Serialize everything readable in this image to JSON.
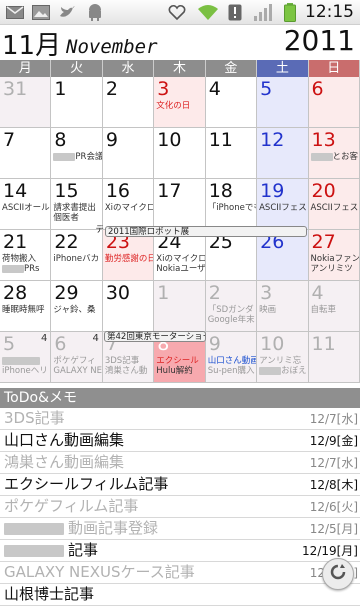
{
  "status": {
    "time": "12:15",
    "icons": [
      "mail-icon",
      "gallery-icon",
      "twitter-icon",
      "android-icon",
      "heart-icon",
      "wifi-icon",
      "alert-icon",
      "signal-icon",
      "battery-icon"
    ]
  },
  "header": {
    "month_label": "11月",
    "month_english": "November",
    "year": "2011"
  },
  "weekdays": [
    "月",
    "火",
    "水",
    "木",
    "金",
    "土",
    "日"
  ],
  "weeks": [
    {
      "days": [
        {
          "num": "31",
          "type": "other"
        },
        {
          "num": "1"
        },
        {
          "num": "2"
        },
        {
          "num": "3",
          "type": "hol",
          "events": [
            {
              "text": "文化の日",
              "color": "red"
            }
          ]
        },
        {
          "num": "4"
        },
        {
          "num": "5",
          "type": "sat"
        },
        {
          "num": "6",
          "type": "sun"
        }
      ]
    },
    {
      "days": [
        {
          "num": "7"
        },
        {
          "num": "8",
          "events": [
            {
              "text": "PR会議",
              "blur_before": true
            }
          ]
        },
        {
          "num": "9"
        },
        {
          "num": "10"
        },
        {
          "num": "11"
        },
        {
          "num": "12",
          "type": "sat"
        },
        {
          "num": "13",
          "type": "sun",
          "events": [
            {
              "text": "とお客",
              "blur_before": true
            }
          ]
        }
      ]
    },
    {
      "days": [
        {
          "num": "14",
          "events": [
            {
              "text": "ASCIIオール"
            }
          ]
        },
        {
          "num": "15",
          "events": [
            {
              "text": "請求書提出"
            },
            {
              "text": "個医者"
            }
          ]
        },
        {
          "num": "16",
          "events": [
            {
              "text": "Xiのマイクロ"
            }
          ]
        },
        {
          "num": "17"
        },
        {
          "num": "18",
          "events": [
            {
              "text": "「iPhoneでも"
            }
          ]
        },
        {
          "num": "19",
          "type": "sat",
          "events": [
            {
              "text": "ASCIIフェス"
            }
          ]
        },
        {
          "num": "20",
          "type": "sun",
          "events": [
            {
              "text": "ASCIIフェス"
            }
          ]
        }
      ]
    },
    {
      "days": [
        {
          "num": "21",
          "events": [
            {
              "text": "荷物搬入"
            },
            {
              "text": "PRs",
              "blur_before": true
            }
          ]
        },
        {
          "num": "22",
          "events": [
            {
              "text": "iPhoneバカ"
            }
          ]
        },
        {
          "num": "23",
          "type": "hol",
          "events": [
            {
              "text": "勤労感謝の日",
              "color": "red"
            }
          ]
        },
        {
          "num": "24",
          "events": [
            {
              "text": "Xiのマイクロ"
            },
            {
              "text": "Nokiaユーザ"
            }
          ]
        },
        {
          "num": "25"
        },
        {
          "num": "26",
          "type": "sat"
        },
        {
          "num": "27",
          "type": "sun",
          "events": [
            {
              "text": "Nokiaファン"
            },
            {
              "text": "アンリミツ"
            }
          ]
        }
      ]
    },
    {
      "days": [
        {
          "num": "28",
          "events": [
            {
              "text": "睡眠時無呼"
            }
          ]
        },
        {
          "num": "29",
          "events": [
            {
              "text": "ジャ鈴、桑"
            }
          ]
        },
        {
          "num": "30"
        },
        {
          "num": "1",
          "type": "other"
        },
        {
          "num": "2",
          "type": "other",
          "events": [
            {
              "text": "「SDガンダ"
            },
            {
              "text": "Google年末"
            }
          ]
        },
        {
          "num": "3",
          "type": "other",
          "events": [
            {
              "text": "映画"
            }
          ]
        },
        {
          "num": "4",
          "type": "other",
          "events": [
            {
              "text": "自転車"
            }
          ]
        }
      ]
    },
    {
      "days": [
        {
          "num": "5",
          "type": "other",
          "badge": "4",
          "events": [
            {
              "text": "",
              "blur_only": true
            },
            {
              "text": "iPhoneヘリ"
            }
          ]
        },
        {
          "num": "6",
          "type": "other",
          "badge": "4",
          "events": [
            {
              "text": "ポケゲフィ"
            },
            {
              "text": "GALAXY NE"
            }
          ]
        },
        {
          "num": "7",
          "type": "other",
          "badge": "4",
          "events": [
            {
              "text": "3DS記事"
            },
            {
              "text": "鴻巣さん動"
            }
          ]
        },
        {
          "num": "8",
          "type": "today",
          "events": [
            {
              "text": "エクシール",
              "color": "red"
            },
            {
              "text": "Hulu解約"
            }
          ]
        },
        {
          "num": "9",
          "type": "other",
          "events": [
            {
              "text": "山口さん動画",
              "color": "blue"
            },
            {
              "text": "Su-pen購入"
            }
          ]
        },
        {
          "num": "10",
          "type": "other",
          "events": [
            {
              "text": "アンリミ忘"
            },
            {
              "text": "おぼえ",
              "blur_before": true
            }
          ]
        },
        {
          "num": "11",
          "type": "other"
        }
      ]
    }
  ],
  "spanning_events": [
    {
      "label": "デ",
      "note": "week2 mon-tue fragment"
    },
    {
      "label": "2011国際ロボット展"
    },
    {
      "label": "第42回東京モーターショー"
    }
  ],
  "todo": {
    "title": "ToDo&メモ",
    "items": [
      {
        "text": "3DS記事",
        "date": "12/7[水]",
        "done": true
      },
      {
        "text": "山口さん動画編集",
        "date": "12/9[金]",
        "done": false
      },
      {
        "text": "鴻巣さん動画編集",
        "date": "12/7[水]",
        "done": true
      },
      {
        "text": "エクシールフィルム記事",
        "date": "12/8[木]",
        "done": false
      },
      {
        "text": "ポケゲフィルム記事",
        "date": "12/6[火]",
        "done": true
      },
      {
        "text": "動画記事登録",
        "date": "12/5[月]",
        "done": true,
        "blur_before": true
      },
      {
        "text": "記事",
        "date": "12/19[月]",
        "done": false,
        "blur_before": true
      },
      {
        "text": "GALAXY NEXUSケース記事",
        "date": "12/5[月]",
        "done": true
      },
      {
        "text": "山根博士記事",
        "date": "",
        "done": false
      }
    ]
  },
  "colors": {
    "saturday_header": "#5a6bb6",
    "sunday_header": "#c96d6d",
    "weekday_header": "#8d8d8d",
    "today_bg": "#f7a9ae",
    "todo_bar": "#8f8f8f"
  }
}
